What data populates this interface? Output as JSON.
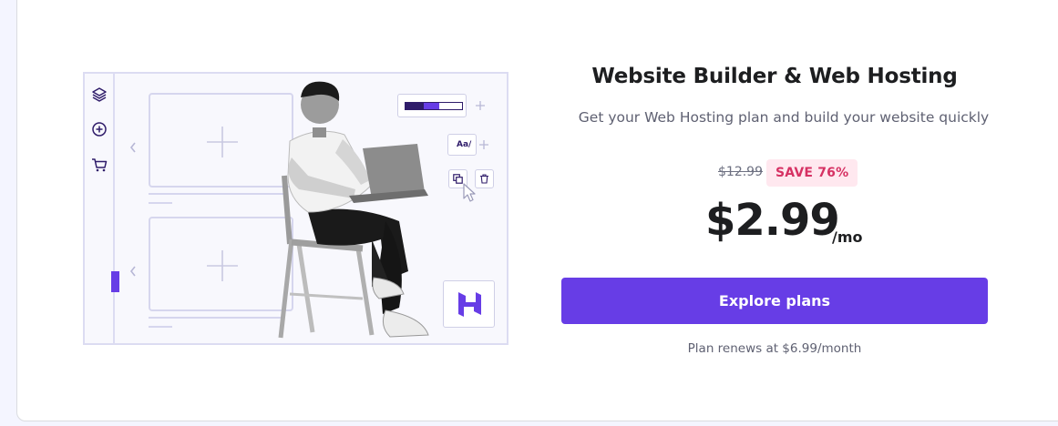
{
  "offer": {
    "title": "Website Builder & Web Hosting",
    "subtitle": "Get your Web Hosting plan and build your website quickly",
    "old_price": "$12.99",
    "save_badge": "SAVE 76%",
    "price": "$2.99",
    "period": "/mo",
    "cta_label": "Explore plans",
    "renewal_note": "Plan renews at $6.99/month"
  },
  "illustration": {
    "font_tool_label": "Aa/",
    "progress_fraction": 0.6,
    "sidebar_icons": [
      "layers-icon",
      "add-circle-icon",
      "cart-icon"
    ],
    "toolbar_icons": [
      "copy-icon",
      "trash-icon",
      "cursor-icon"
    ],
    "logo": "hostinger-logo"
  },
  "colors": {
    "accent": "#673de6",
    "accent_dark": "#2f1c6a",
    "badge_bg": "#ffe8ef",
    "badge_text": "#d63163",
    "text": "#1d1e20",
    "muted": "#5f6172"
  }
}
